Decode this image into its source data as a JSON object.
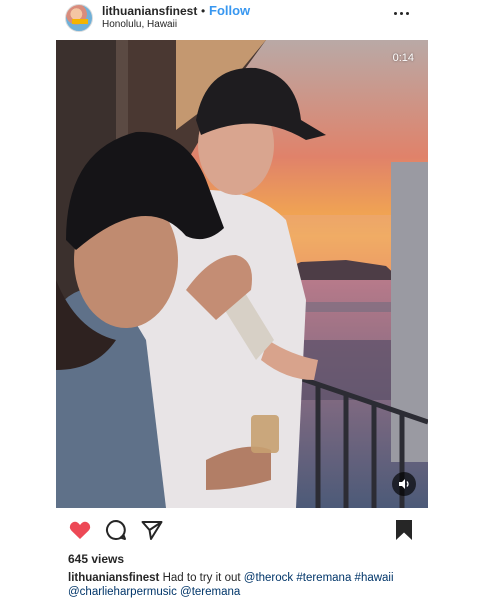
{
  "header": {
    "username": "lithuaniansfinest",
    "separator": "•",
    "follow_label": "Follow",
    "location": "Honolulu, Hawaii",
    "more_icon": "more-horizontal-icon"
  },
  "media": {
    "type": "video",
    "timer": "0:14",
    "sound_icon": "speaker-icon"
  },
  "actions": {
    "like_icon": "heart-filled-icon",
    "like_color": "#ed4956",
    "comment_icon": "comment-icon",
    "share_icon": "share-paper-plane-icon",
    "save_icon": "bookmark-filled-icon"
  },
  "views": "645 views",
  "caption": {
    "username": "lithuaniansfinest",
    "text": "Had to try it out",
    "mention_1": "@therock",
    "hashtag_1": "#teremana",
    "hashtag_2": "#hawaii",
    "mention_2": "@charlieharpermusic",
    "mention_3": "@teremana"
  },
  "colors": {
    "link": "#3897f0",
    "tag": "#003569",
    "text": "#262626"
  }
}
